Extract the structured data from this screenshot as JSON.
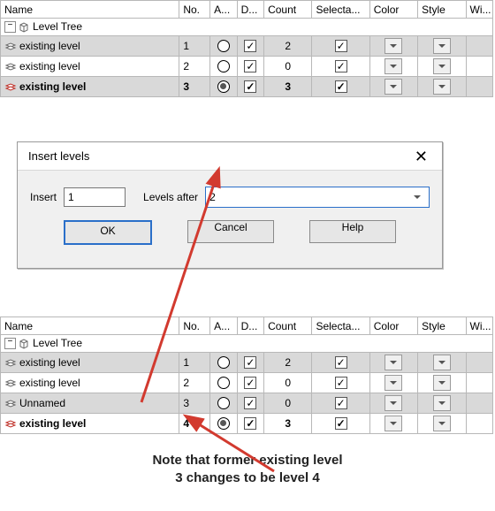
{
  "tables": {
    "headers": {
      "name": "Name",
      "no": "No.",
      "a": "A...",
      "d": "D...",
      "count": "Count",
      "sel": "Selecta...",
      "color": "Color",
      "style": "Style",
      "wi": "Wi..."
    },
    "root_label": "Level Tree",
    "before": {
      "rows": [
        {
          "name": "existing level",
          "no": "1",
          "active": false,
          "display": true,
          "count": "2",
          "selectable": true,
          "selected": true,
          "bold": false
        },
        {
          "name": "existing level",
          "no": "2",
          "active": false,
          "display": true,
          "count": "0",
          "selectable": true,
          "selected": false,
          "bold": false
        },
        {
          "name": "existing level",
          "no": "3",
          "active": true,
          "display": true,
          "count": "3",
          "selectable": true,
          "selected": true,
          "bold": true
        }
      ]
    },
    "after": {
      "rows": [
        {
          "name": "existing level",
          "no": "1",
          "active": false,
          "display": true,
          "count": "2",
          "selectable": true,
          "selected": true,
          "bold": false
        },
        {
          "name": "existing level",
          "no": "2",
          "active": false,
          "display": true,
          "count": "0",
          "selectable": true,
          "selected": false,
          "bold": false
        },
        {
          "name": "Unnamed",
          "no": "3",
          "active": false,
          "display": true,
          "count": "0",
          "selectable": true,
          "selected": true,
          "bold": false
        },
        {
          "name": "existing level",
          "no": "4",
          "active": true,
          "display": true,
          "count": "3",
          "selectable": true,
          "selected": false,
          "bold": true
        }
      ]
    }
  },
  "dialog": {
    "title": "Insert levels",
    "insert_label": "Insert",
    "insert_value": "1",
    "after_label": "Levels after",
    "after_value": "2",
    "ok": "OK",
    "cancel": "Cancel",
    "help": "Help"
  },
  "annotation": {
    "line1": "Note that former existing level",
    "line2": "3 changes to be level 4"
  },
  "colors": {
    "arrow": "#d23a2f"
  }
}
